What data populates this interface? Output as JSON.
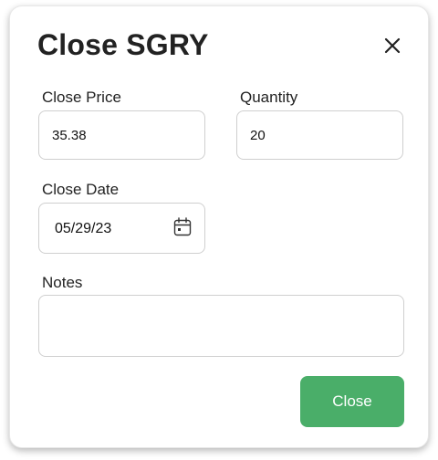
{
  "dialog": {
    "title": "Close SGRY",
    "close_icon": "close-icon"
  },
  "fields": {
    "close_price": {
      "label": "Close Price",
      "value": "35.38"
    },
    "quantity": {
      "label": "Quantity",
      "value": "20"
    },
    "close_date": {
      "label": "Close Date",
      "value": "05/29/23",
      "icon": "calendar-icon"
    },
    "notes": {
      "label": "Notes",
      "value": ""
    }
  },
  "actions": {
    "submit_label": "Close"
  },
  "colors": {
    "primary_button": "#4aae69",
    "text": "#222222",
    "border": "#cfcfcf"
  }
}
